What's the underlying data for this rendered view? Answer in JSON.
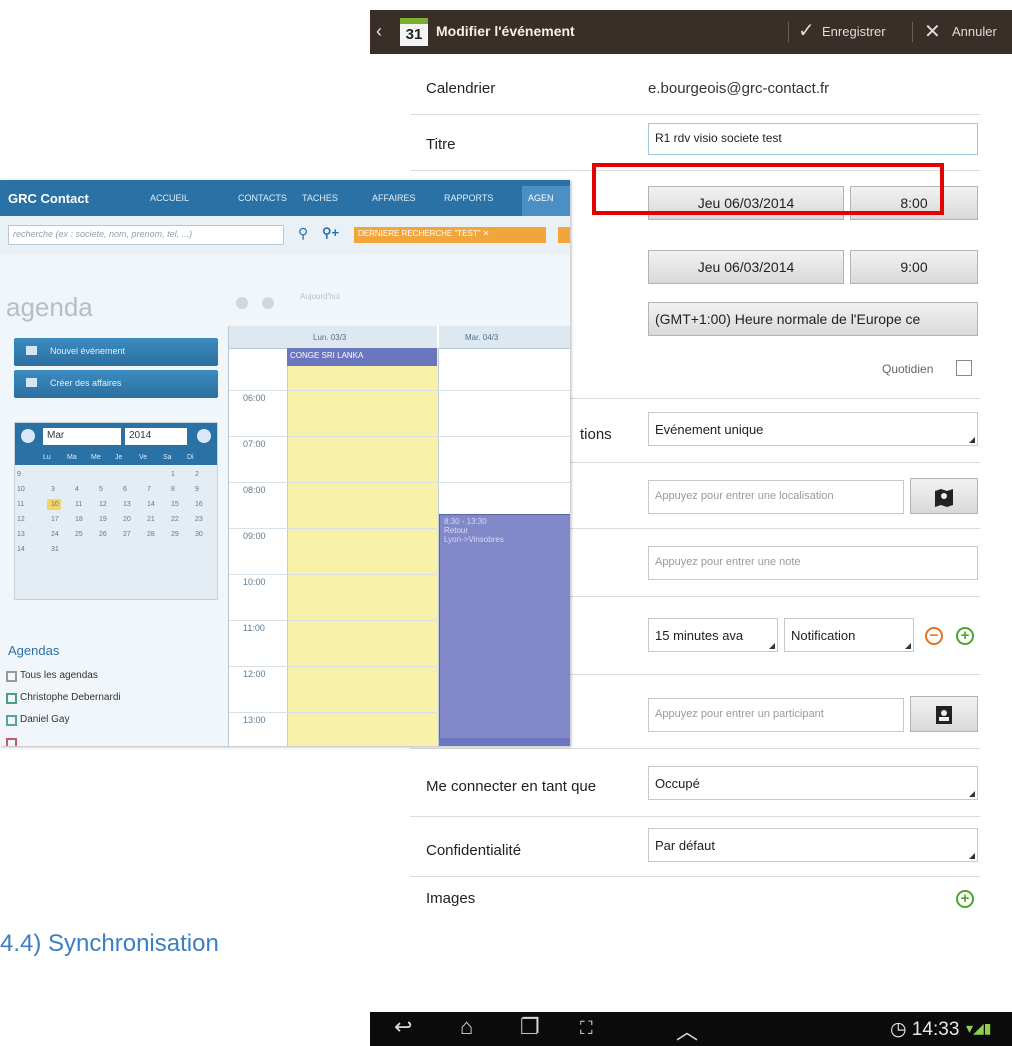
{
  "android": {
    "action_bar": {
      "back": "‹",
      "calendar_day": "31",
      "title": "Modifier l'événement",
      "save": "Enregistrer",
      "cancel": "Annuler"
    },
    "form": {
      "calendar_label": "Calendrier",
      "calendar_value": "e.bourgeois@grc-contact.fr",
      "title_label": "Titre",
      "title_value": "R1 rdv visio societe test",
      "start_date": "Jeu 06/03/2014",
      "start_time": "8:00",
      "end_date": "Jeu 06/03/2014",
      "end_time": "9:00",
      "timezone": "(GMT+1:00) Heure normale de l'Europe ce",
      "daily_label": "Quotidien",
      "repeat_label": "tions",
      "repeat_value": "Evénement unique",
      "location_placeholder": "Appuyez pour entrer une localisation",
      "note_placeholder": "Appuyez pour entrer une note",
      "reminder_time": "15 minutes ava",
      "reminder_type": "Notification",
      "participant_placeholder": "Appuyez pour entrer un participant",
      "show_as_label": "Me connecter en tant que",
      "show_as_value": "Occupé",
      "privacy_label": "Confidentialité",
      "privacy_value": "Par défaut",
      "images_label": "Images"
    },
    "status": {
      "time": "14:33"
    }
  },
  "desktop": {
    "logo": "GRC Contact",
    "nav": [
      "ACCUEIL",
      "CONTACTS",
      "TACHES",
      "AFFAIRES",
      "RAPPORTS"
    ],
    "nav_selected": "AGEN",
    "search_placeholder": "recherche (ex : societe, nom, prenom, tel, ...)",
    "last_search": "DERNIERE RECHERCHE \"TEST\" ✕",
    "page_title": "agenda",
    "aujourdhui": "Aujourd'hui",
    "btn_new_event": "Nouvel événement",
    "btn_create_deals": "Créer des affaires",
    "mini": {
      "month": "Mar",
      "year": "2014",
      "weekdays": [
        "Lu",
        "Ma",
        "Me",
        "Je",
        "Ve",
        "Sa",
        "Di"
      ],
      "weeks": [
        [
          "9",
          "",
          "",
          "",
          "",
          "",
          "1",
          "2"
        ],
        [
          "10",
          "3",
          "4",
          "5",
          "6",
          "7",
          "8",
          "9"
        ],
        [
          "11",
          "10",
          "11",
          "12",
          "13",
          "14",
          "15",
          "16"
        ],
        [
          "12",
          "17",
          "18",
          "19",
          "20",
          "21",
          "22",
          "23"
        ],
        [
          "13",
          "24",
          "25",
          "26",
          "27",
          "28",
          "29",
          "30"
        ],
        [
          "14",
          "31",
          "",
          "",
          "",
          "",
          "",
          ""
        ]
      ]
    },
    "agendas_title": "Agendas",
    "agendas": [
      "Tous les agendas",
      "Christophe Debernardi",
      "Daniel Gay"
    ],
    "cal": {
      "col1": "Lun. 03/3",
      "col2": "Mar. 04/3",
      "allday_event": "CONGE SRI LANKA",
      "event_time": "8:30 - 13:30",
      "event_title": "Retour",
      "event_loc": "Lyon->Vinsobres",
      "hours": [
        "06:00",
        "07:00",
        "08:00",
        "09:00",
        "10:00",
        "11:00",
        "12:00",
        "13:00"
      ]
    }
  },
  "caption": "4.4) Synchronisation",
  "colors": {
    "action_bar": "#3a2f28",
    "highlight": "#e60000",
    "desktop_nav": "#2a72a6",
    "allday_bg": "#f7f1a9",
    "event": "#8189c8",
    "caption": "#3a7ec3"
  }
}
